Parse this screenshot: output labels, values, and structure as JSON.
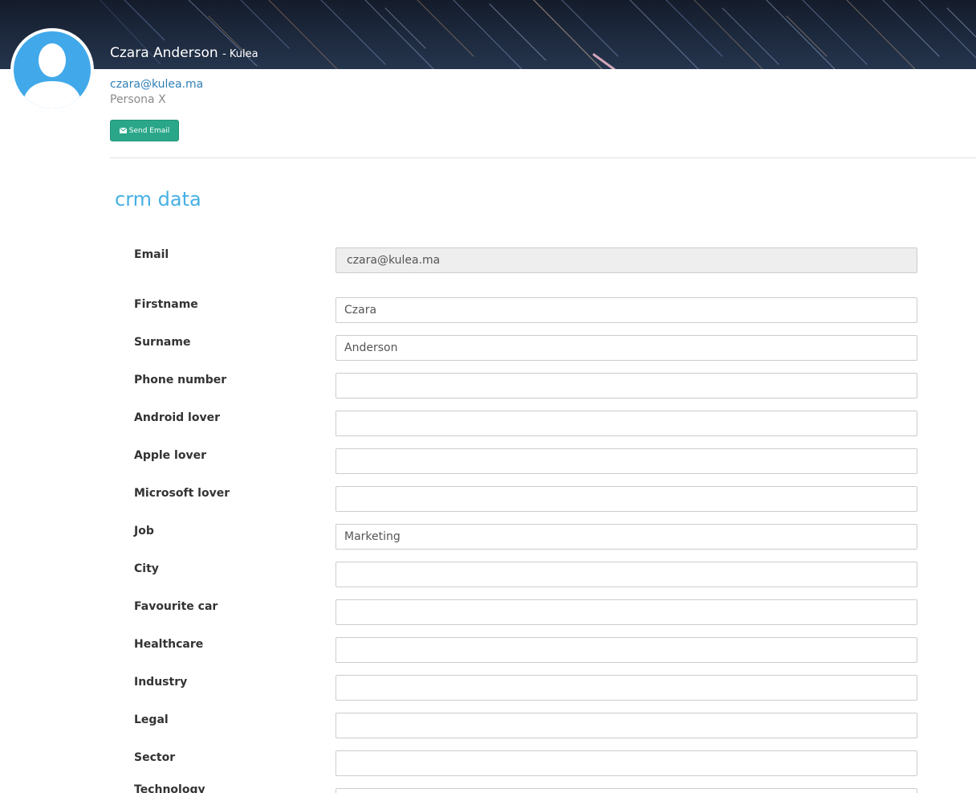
{
  "profile": {
    "name": "Czara Anderson",
    "company": "- Kulea",
    "email": "czara@kulea.ma",
    "persona": "Persona X",
    "send_email_label": "Send Email"
  },
  "section": {
    "title": "crm data"
  },
  "fields": [
    {
      "label": "Email",
      "value": "czara@kulea.ma",
      "readonly": true
    },
    {
      "label": "Firstname",
      "value": "Czara"
    },
    {
      "label": "Surname",
      "value": "Anderson"
    },
    {
      "label": "Phone number",
      "value": ""
    },
    {
      "label": "Android lover",
      "value": ""
    },
    {
      "label": "Apple lover",
      "value": ""
    },
    {
      "label": "Microsoft lover",
      "value": ""
    },
    {
      "label": "Job",
      "value": "Marketing"
    },
    {
      "label": "City",
      "value": ""
    },
    {
      "label": "Favourite car",
      "value": ""
    },
    {
      "label": "Healthcare",
      "value": ""
    },
    {
      "label": "Industry",
      "value": ""
    },
    {
      "label": "Legal",
      "value": ""
    },
    {
      "label": "Sector",
      "value": ""
    },
    {
      "label": "Technology",
      "value": ""
    }
  ],
  "colors": {
    "accent": "#46b0e4",
    "button": "#2aa789",
    "link": "#2f7fb6",
    "avatar": "#41a9ea"
  },
  "icons": {
    "avatar": "user-silhouette-icon",
    "send_email": "envelope-icon"
  }
}
